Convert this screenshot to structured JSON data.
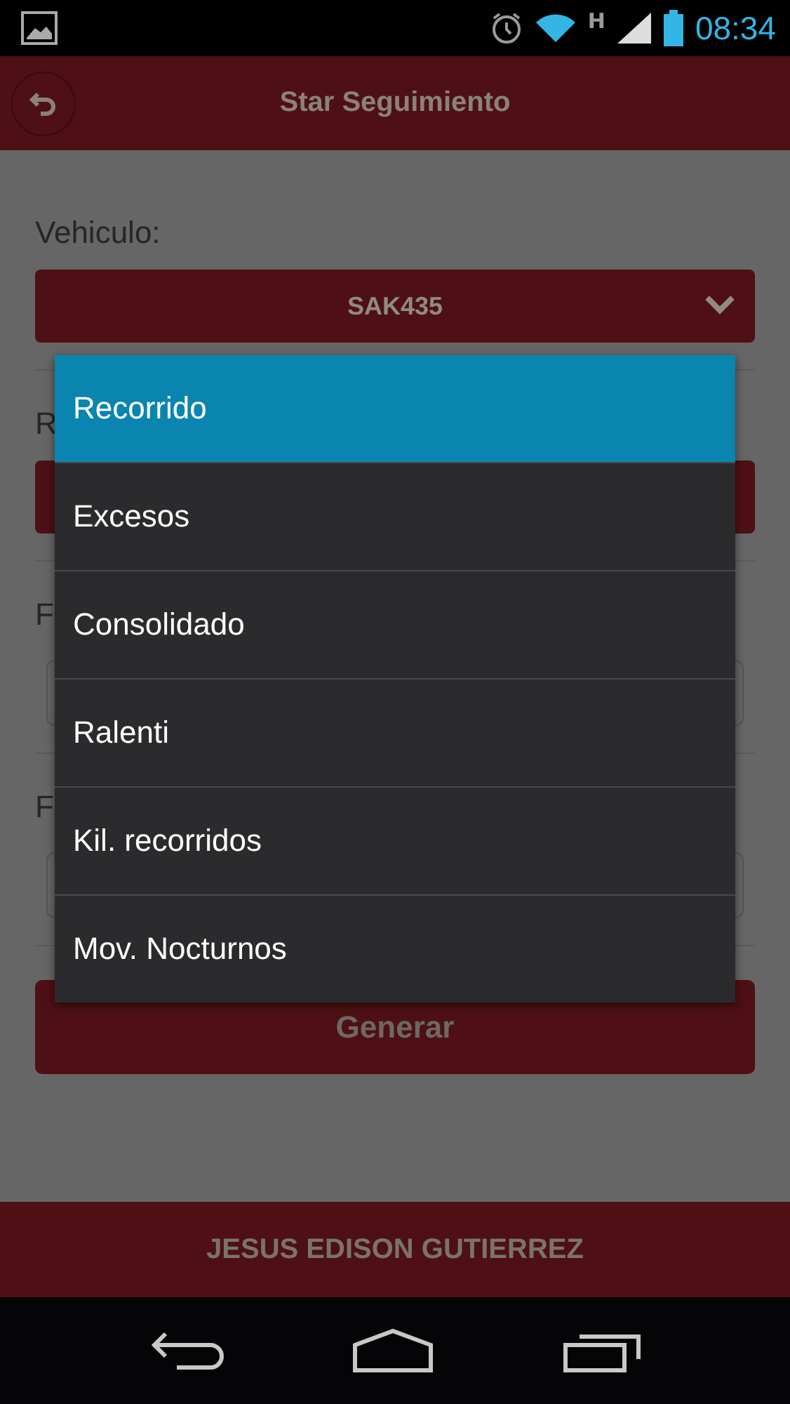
{
  "status_bar": {
    "network_type": "H",
    "time": "08:34"
  },
  "header": {
    "title": "Star Seguimiento"
  },
  "form": {
    "fields": [
      {
        "kind": "select",
        "label": "Vehiculo:",
        "value": "SAK435"
      },
      {
        "kind": "select",
        "label": "R"
      },
      {
        "kind": "input",
        "label": "F"
      },
      {
        "kind": "input",
        "label": "F"
      }
    ],
    "submit_button": "Generar"
  },
  "dropdown": {
    "options": [
      {
        "label": "Recorrido",
        "selected": true
      },
      {
        "label": "Excesos",
        "selected": false
      },
      {
        "label": "Consolidado",
        "selected": false
      },
      {
        "label": "Ralenti",
        "selected": false
      },
      {
        "label": "Kil. recorridos",
        "selected": false
      },
      {
        "label": "Mov. Nocturnos",
        "selected": false
      }
    ]
  },
  "footer": {
    "user": "JESUS EDISON GUTIERREZ"
  }
}
